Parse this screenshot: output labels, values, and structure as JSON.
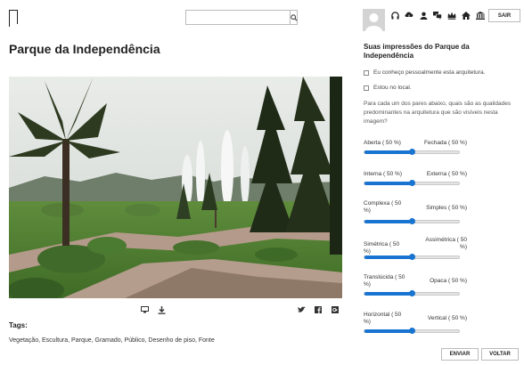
{
  "header": {
    "logo_icon": "logo-icon",
    "search": {
      "placeholder": "",
      "value": "",
      "icon": "search-icon"
    }
  },
  "user": {
    "avatar_icon": "avatar-icon",
    "toolbar_icons": [
      "headphones-icon",
      "cloud-download-icon",
      "user-icon",
      "chat-icon",
      "crown-icon",
      "home-icon",
      "museum-icon"
    ],
    "logout_label": "SAIR"
  },
  "main": {
    "title": "Parque da Independência",
    "photo_icon": "landscape-photo",
    "tools": {
      "left": [
        "compare-icon",
        "download-icon"
      ],
      "share": [
        "twitter-icon",
        "facebook-icon",
        "google-plus-icon"
      ]
    },
    "tags_label": "Tags:",
    "tags": "Vegetação, Escultura, Parque, Gramado, Público, Desenho de piso, Fonte"
  },
  "survey": {
    "title": "Suas impressões do Parque da Independência",
    "checks": [
      {
        "label": "Eu conheço pessoalmente esta arquitetura.",
        "checked": false
      },
      {
        "label": "Estou no local.",
        "checked": false
      }
    ],
    "instruction": "Para cada um dos pares abaixo, quais são as qualidades predominantes na arquitetura que são visíveis nesta imagem?",
    "pairs": [
      {
        "left": "Aberta ( 50 %)",
        "right": "Fechada ( 50 %)",
        "value": 0.5
      },
      {
        "left": "Interna ( 50 %)",
        "right": "Externa ( 50 %)",
        "value": 0.5
      },
      {
        "left": "Complexa ( 50 %)",
        "right": "Simples ( 50 %)",
        "value": 0.5
      },
      {
        "left": "Simétrica ( 50 %)",
        "right": "Assimétrica ( 50 %)",
        "value": 0.5
      },
      {
        "left": "Translúcida ( 50 %)",
        "right": "Opaca ( 50 %)",
        "value": 0.5
      },
      {
        "left": "Horizontal ( 50 %)",
        "right": "Vertical ( 50 %)",
        "value": 0.5
      }
    ],
    "submit_label": "ENVIAR",
    "back_label": "VOLTAR"
  },
  "colors": {
    "accent": "#1874d0"
  }
}
